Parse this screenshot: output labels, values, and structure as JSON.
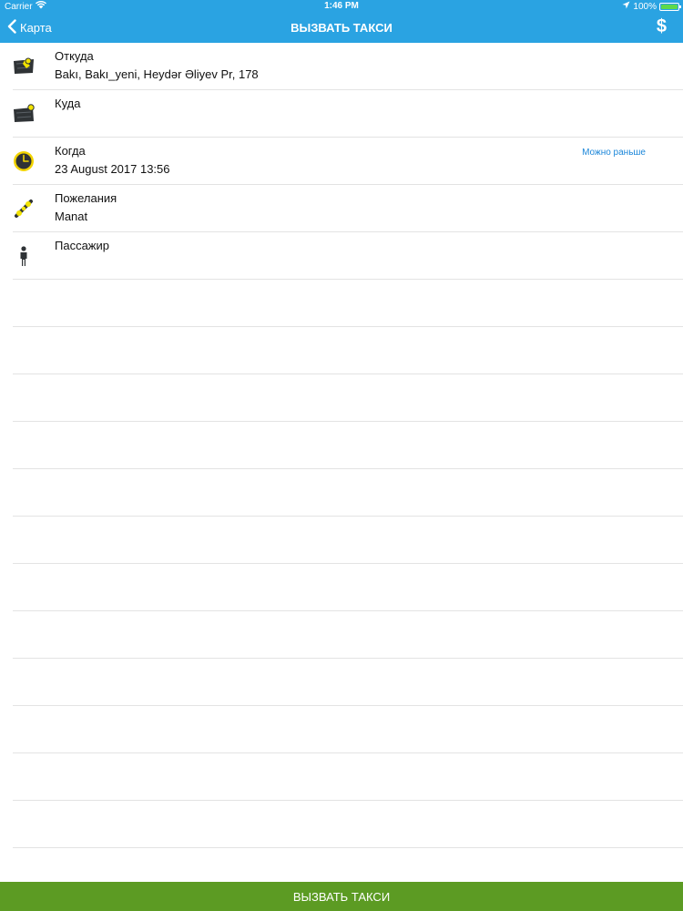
{
  "status_bar": {
    "carrier": "Carrier",
    "time": "1:46 PM",
    "battery": "100%"
  },
  "nav": {
    "back_label": "Карта",
    "title": "ВЫЗВАТЬ ТАКСИ",
    "price_icon": "dollar-icon"
  },
  "fields": [
    {
      "label": "Откуда",
      "value": "Bakı, Bakı_yeni, Heydər Əliyev Pr, 178",
      "icon": "map-pin-from-icon"
    },
    {
      "label": "Куда",
      "value": "",
      "icon": "map-pin-to-icon"
    },
    {
      "label": "Когда",
      "value": "23 August 2017 13:56",
      "action": "Можно раньше",
      "icon": "clock-icon"
    },
    {
      "label": "Пожелания",
      "value": "Manat",
      "icon": "wishes-icon"
    },
    {
      "label": "Пассажир",
      "value": "",
      "icon": "passenger-icon"
    }
  ],
  "empty_rows": 13,
  "submit_label": "ВЫЗВАТЬ ТАКСИ",
  "colors": {
    "header": "#2aa3e2",
    "submit": "#5c9b23",
    "link": "#1b86d9",
    "icon_accent": "#f2e300"
  }
}
